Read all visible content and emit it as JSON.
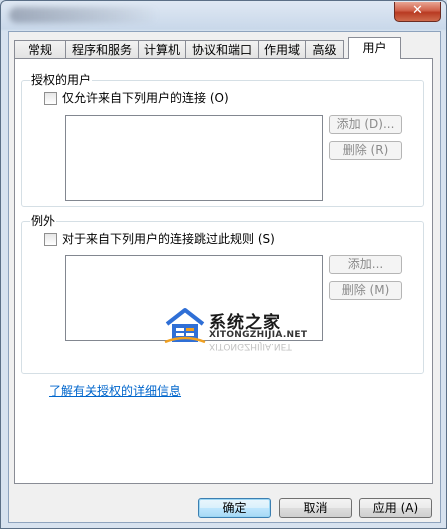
{
  "window": {
    "close_glyph": "✕"
  },
  "tabs": [
    {
      "label": "常规"
    },
    {
      "label": "程序和服务"
    },
    {
      "label": "计算机"
    },
    {
      "label": "协议和端口"
    },
    {
      "label": "作用域"
    },
    {
      "label": "高级"
    },
    {
      "label": "用户",
      "active": true
    }
  ],
  "authorized_users": {
    "title": "授权的用户",
    "checkbox_label": "仅允许来自下列用户的连接 (O)",
    "checked": false,
    "add_label": "添加 (D)...",
    "remove_label": "删除 (R)"
  },
  "exceptions": {
    "title": "例外",
    "checkbox_label": "对于来自下列用户的连接跳过此规则 (S)",
    "checked": false,
    "add_label": "添加...",
    "remove_label": "删除 (M)"
  },
  "help_link": "了解有关授权的详细信息",
  "buttons": {
    "ok": "确定",
    "cancel": "取消",
    "apply": "应用 (A)"
  },
  "watermark": {
    "text": "系统之家",
    "sub": "XITONGZHIJIA.NET",
    "colors": {
      "blue": "#2f6fd6",
      "orange": "#f0a020"
    }
  }
}
